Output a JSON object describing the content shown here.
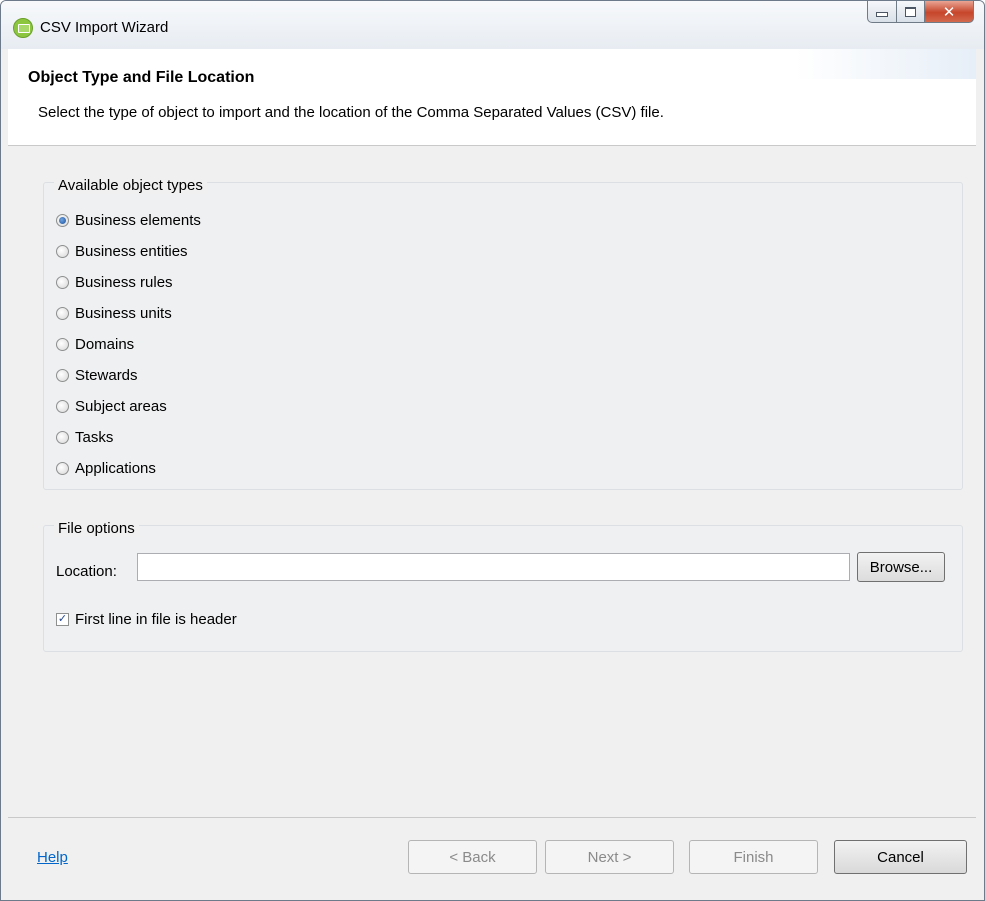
{
  "window": {
    "title": "CSV Import Wizard",
    "controls": [
      "minimize",
      "maximize",
      "close"
    ]
  },
  "header": {
    "title": "Object Type and File Location",
    "description": "Select the type of object to import and the location of the Comma Separated Values (CSV) file."
  },
  "object_types": {
    "legend": "Available object types",
    "selected": "Business elements",
    "items": [
      {
        "label": "Business elements",
        "checked": true
      },
      {
        "label": "Business entities",
        "checked": false
      },
      {
        "label": "Business rules",
        "checked": false
      },
      {
        "label": "Business units",
        "checked": false
      },
      {
        "label": "Domains",
        "checked": false
      },
      {
        "label": "Stewards",
        "checked": false
      },
      {
        "label": "Subject areas",
        "checked": false
      },
      {
        "label": "Tasks",
        "checked": false
      },
      {
        "label": "Applications",
        "checked": false
      }
    ]
  },
  "file_options": {
    "legend": "File options",
    "location_label": "Location:",
    "location_value": "",
    "browse_label": "Browse...",
    "header_checkbox_label": "First line in file is header",
    "header_checkbox_checked": true
  },
  "footer": {
    "help_label": "Help",
    "back_label": "< Back",
    "next_label": "Next >",
    "finish_label": "Finish",
    "cancel_label": "Cancel",
    "back_enabled": false,
    "next_enabled": false,
    "finish_enabled": false,
    "cancel_enabled": true
  },
  "colors": {
    "link": "#0066cc",
    "close_button": "#c6452a",
    "app_icon": "#8cc63f"
  }
}
